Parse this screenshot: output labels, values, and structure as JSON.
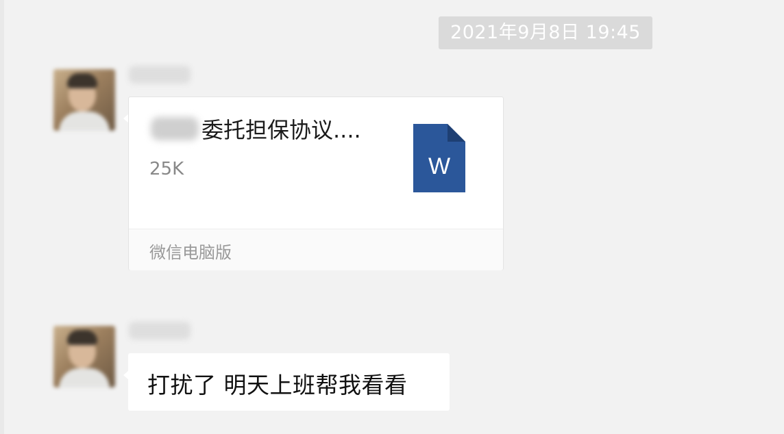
{
  "chat": {
    "timestamp": "2021年9月8日 19:45",
    "messages": [
      {
        "type": "file",
        "avatar_icon": "user-avatar",
        "file": {
          "name": "委托担保协议....",
          "size": "25K",
          "icon": "word-doc-icon",
          "icon_letter": "W",
          "icon_color": "#2b579a",
          "source": "微信电脑版"
        }
      },
      {
        "type": "text",
        "avatar_icon": "user-avatar",
        "text": "打扰了 明天上班帮我看看"
      }
    ]
  },
  "colors": {
    "background": "#f2f2f2",
    "bubble": "#ffffff",
    "timestamp_bg": "#dadada",
    "word_blue": "#2b579a"
  }
}
